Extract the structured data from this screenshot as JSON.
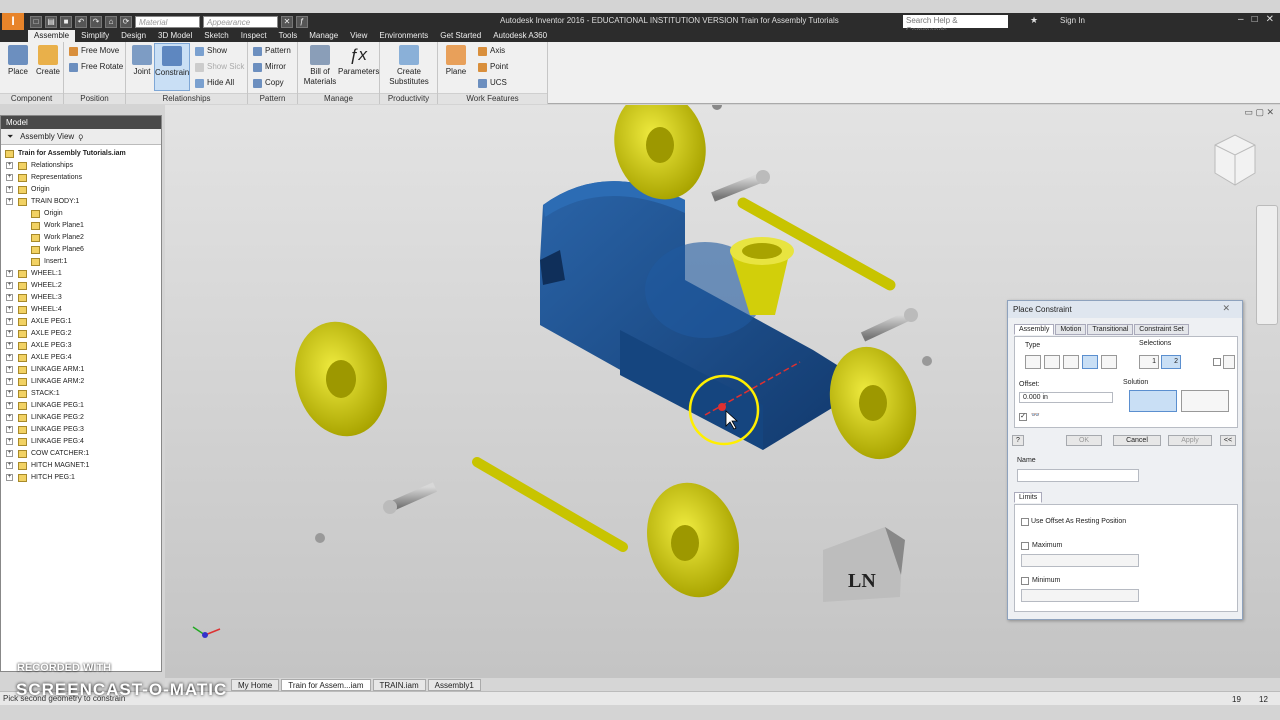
{
  "title_bar": {
    "logo": "I",
    "document_title": "Autodesk Inventor 2016 - EDUCATIONAL INSTITUTION VERSION   Train for Assembly Tutorials",
    "material_placeholder": "Material",
    "appearance_placeholder": "Appearance",
    "help_search_placeholder": "Search Help & Commands...",
    "sign_in": "Sign In"
  },
  "ribbon_tabs": [
    "Assemble",
    "Simplify",
    "Design",
    "3D Model",
    "Sketch",
    "Inspect",
    "Tools",
    "Manage",
    "View",
    "Environments",
    "Get Started",
    "Autodesk A360"
  ],
  "ribbon": {
    "place": "Place",
    "create": "Create",
    "free_move": "Free Move",
    "free_rotate": "Free Rotate",
    "joint": "Joint",
    "constrain": "Constrain",
    "show": "Show",
    "show_sick": "Show Sick",
    "hide_all": "Hide All",
    "pattern": "Pattern",
    "mirror": "Mirror",
    "copy": "Copy",
    "bill_of_materials": "Bill of Materials",
    "parameters": "Parameters",
    "create_substitutes": "Create Substitutes",
    "plane": "Plane",
    "axis": "Axis",
    "point": "Point",
    "ucs": "UCS",
    "panels": {
      "component": "Component",
      "position": "Position",
      "relationships": "Relationships",
      "pattern": "Pattern",
      "manage": "Manage",
      "productivity": "Productivity",
      "work_features": "Work Features"
    }
  },
  "browser": {
    "header": "Model",
    "view": "Assembly View",
    "tree": [
      {
        "label": "Train for Assembly Tutorials.iam",
        "level": 0,
        "bold": true
      },
      {
        "label": "Relationships",
        "level": 1
      },
      {
        "label": "Representations",
        "level": 1
      },
      {
        "label": "Origin",
        "level": 1
      },
      {
        "label": "TRAIN BODY:1",
        "level": 1
      },
      {
        "label": "Origin",
        "level": 2
      },
      {
        "label": "Work Plane1",
        "level": 2
      },
      {
        "label": "Work Plane2",
        "level": 2
      },
      {
        "label": "Work Plane6",
        "level": 2
      },
      {
        "label": "Insert:1",
        "level": 2
      },
      {
        "label": "WHEEL:1",
        "level": 1
      },
      {
        "label": "WHEEL:2",
        "level": 1
      },
      {
        "label": "WHEEL:3",
        "level": 1
      },
      {
        "label": "WHEEL:4",
        "level": 1
      },
      {
        "label": "AXLE PEG:1",
        "level": 1
      },
      {
        "label": "AXLE PEG:2",
        "level": 1
      },
      {
        "label": "AXLE PEG:3",
        "level": 1
      },
      {
        "label": "AXLE PEG:4",
        "level": 1
      },
      {
        "label": "LINKAGE ARM:1",
        "level": 1
      },
      {
        "label": "LINKAGE ARM:2",
        "level": 1
      },
      {
        "label": "STACK:1",
        "level": 1
      },
      {
        "label": "LINKAGE PEG:1",
        "level": 1
      },
      {
        "label": "LINKAGE PEG:2",
        "level": 1
      },
      {
        "label": "LINKAGE PEG:3",
        "level": 1
      },
      {
        "label": "LINKAGE PEG:4",
        "level": 1
      },
      {
        "label": "COW CATCHER:1",
        "level": 1
      },
      {
        "label": "HITCH MAGNET:1",
        "level": 1
      },
      {
        "label": "HITCH PEG:1",
        "level": 1
      }
    ]
  },
  "dialog": {
    "title": "Place Constraint",
    "tabs": [
      "Assembly",
      "Motion",
      "Transitional",
      "Constraint Set"
    ],
    "type_label": "Type",
    "selections_label": "Selections",
    "offset_label": "Offset:",
    "offset_value": "0.000 in",
    "solution_label": "Solution",
    "ok": "OK",
    "cancel": "Cancel",
    "apply": "Apply",
    "more": "<<",
    "name_label": "Name",
    "limits_tab": "Limits",
    "use_offset": "Use Offset As Resting Position",
    "maximum": "Maximum",
    "minimum": "Minimum",
    "sel1": "1",
    "sel2": "2"
  },
  "doc_tabs": [
    "My Home",
    "Train for Assem...iam",
    "TRAIN.iam",
    "Assembly1"
  ],
  "status": {
    "text": "Pick second geometry to constrain",
    "n1": "19",
    "n2": "12"
  },
  "watermark": {
    "line1": "RECORDED WITH",
    "line2": "SCREENCAST-O-MATIC"
  },
  "colors": {
    "wheel_yellow": "#c8c400",
    "body_blue": "#1e4f8c",
    "bolt_grey": "#9a9a9a",
    "accent_blue": "#3d78c2"
  },
  "cow_catcher_label": "LN"
}
